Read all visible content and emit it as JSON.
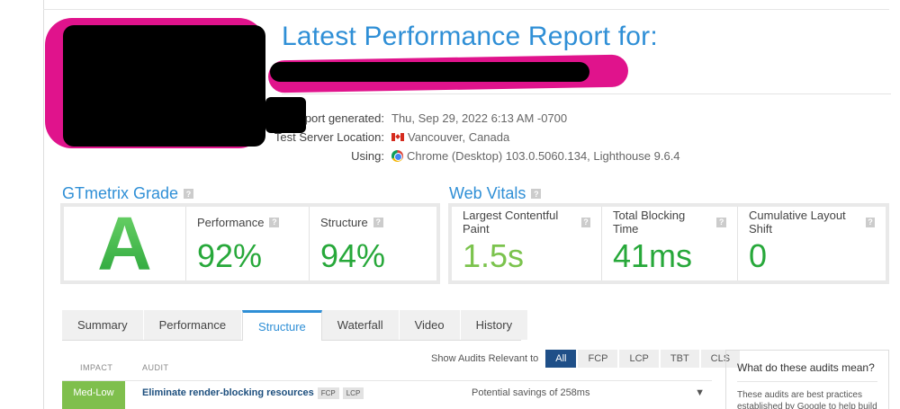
{
  "header": {
    "title": "Latest Performance Report for:"
  },
  "meta": {
    "report_generated_label": "port generated:",
    "report_generated_value": "Thu, Sep 29, 2022 6:13 AM -0700",
    "server_label": "Test Server Location:",
    "server_value": "Vancouver, Canada",
    "using_label": "Using:",
    "using_value": "Chrome (Desktop) 103.0.5060.134, Lighthouse 9.6.4"
  },
  "grade": {
    "title": "GTmetrix Grade",
    "help": "?",
    "letter": "A",
    "performance_label": "Performance",
    "performance_value": "92%",
    "structure_label": "Structure",
    "structure_value": "94%"
  },
  "vitals": {
    "title": "Web Vitals",
    "help": "?",
    "lcp_label": "Largest Contentful Paint",
    "lcp_value": "1.5s",
    "tbt_label": "Total Blocking Time",
    "tbt_value": "41ms",
    "cls_label": "Cumulative Layout Shift",
    "cls_value": "0"
  },
  "tabs": [
    "Summary",
    "Performance",
    "Structure",
    "Waterfall",
    "Video",
    "History"
  ],
  "active_tab": "Structure",
  "audits": {
    "impact_header": "IMPACT",
    "audit_header": "AUDIT",
    "filter_label": "Show Audits Relevant to",
    "filters": [
      "All",
      "FCP",
      "LCP",
      "TBT",
      "CLS"
    ],
    "rows": [
      {
        "impact": "Med-Low",
        "name": "Eliminate render-blocking resources",
        "tags": [
          "FCP",
          "LCP"
        ],
        "savings": "Potential savings of 258ms"
      }
    ]
  },
  "sidebar": {
    "title": "What do these audits mean?",
    "text": "These audits are best practices established by Google to help build"
  },
  "colors": {
    "accent": "#2f8fd6",
    "good": "#27a83a",
    "impact_med_low": "#7fbf4d",
    "redaction": "#e0138c"
  }
}
